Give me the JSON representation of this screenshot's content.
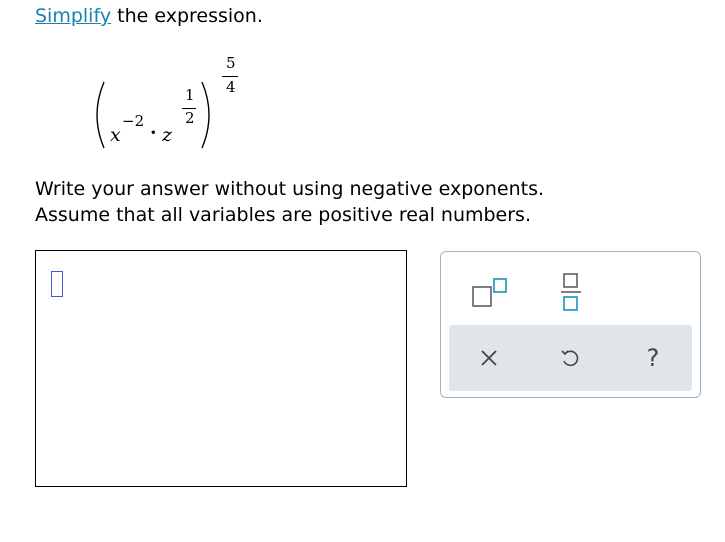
{
  "instruction": {
    "link_text": "Simplify",
    "rest_text": " the expression."
  },
  "expression": {
    "base1": "x",
    "exp1": "−2",
    "dot": "·",
    "base2": "z",
    "exp2_numerator": "1",
    "exp2_denominator": "2",
    "outer_numerator": "5",
    "outer_denominator": "4"
  },
  "directions": {
    "line1": "Write your answer without using negative exponents.",
    "line2": "Assume that all variables are positive real numbers."
  },
  "palette": {
    "top_tools": [
      "superscript-icon",
      "fraction-icon"
    ],
    "bottom_tools": [
      "clear-icon",
      "undo-icon",
      "help-icon"
    ],
    "help_label": "?"
  },
  "colors": {
    "link": "#1683b0",
    "tool_accent": "#2aa3c6",
    "palette_border": "#9fb5c5",
    "palette_bottom_bg": "#dfe5e9",
    "cursor_slot": "#3f5ed8"
  }
}
